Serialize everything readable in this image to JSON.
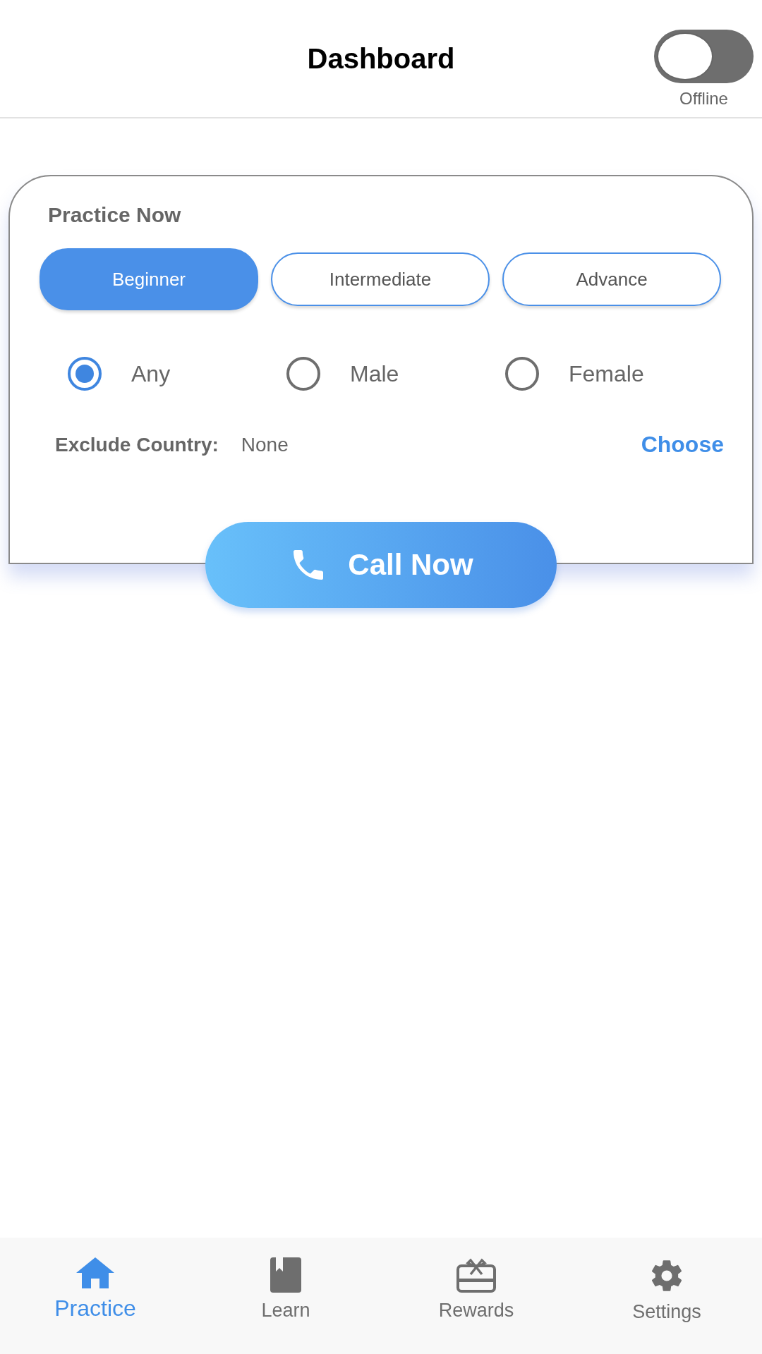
{
  "header": {
    "title": "Dashboard",
    "toggle": {
      "on": false,
      "label": "Offline"
    }
  },
  "practice": {
    "title": "Practice Now",
    "levels": [
      {
        "label": "Beginner",
        "selected": true
      },
      {
        "label": "Intermediate",
        "selected": false
      },
      {
        "label": "Advance",
        "selected": false
      }
    ],
    "genders": [
      {
        "label": "Any",
        "selected": true
      },
      {
        "label": "Male",
        "selected": false
      },
      {
        "label": "Female",
        "selected": false
      }
    ],
    "exclude_country": {
      "label": "Exclude Country:",
      "value": "None",
      "action": "Choose"
    },
    "call_button": "Call Now"
  },
  "nav": [
    {
      "kind": "home",
      "label": "Practice",
      "selected": true
    },
    {
      "kind": "book",
      "label": "Learn",
      "selected": false
    },
    {
      "kind": "gift",
      "label": "Rewards",
      "selected": false
    },
    {
      "kind": "gear",
      "label": "Settings",
      "selected": false
    }
  ]
}
